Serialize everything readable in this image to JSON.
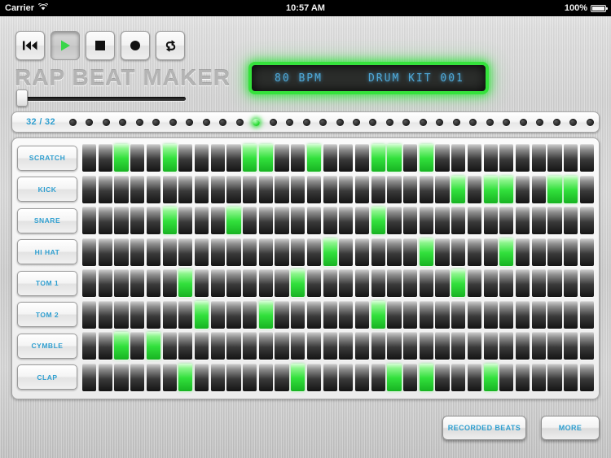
{
  "status_bar": {
    "carrier": "Carrier",
    "wifi_icon": "wifi-icon",
    "time": "10:57 AM",
    "battery_percent": "100%",
    "battery_icon": "battery-full-icon"
  },
  "app": {
    "title": "RAP BEAT MAKER"
  },
  "transport": {
    "buttons": [
      {
        "name": "rewind-button",
        "icon": "rewind-icon",
        "active": false
      },
      {
        "name": "play-button",
        "icon": "play-icon",
        "active": true
      },
      {
        "name": "stop-button",
        "icon": "stop-icon",
        "active": false
      },
      {
        "name": "record-button",
        "icon": "record-icon",
        "active": false
      },
      {
        "name": "loop-button",
        "icon": "loop-icon",
        "active": false
      }
    ]
  },
  "volume_slider": {
    "name": "volume-slider",
    "value_percent": 2
  },
  "lcd": {
    "bpm": "80 BPM",
    "kit": "DRUM KIT 001",
    "text_color": "#4ea8d8",
    "glow_color": "#35e23c"
  },
  "step_bar": {
    "count_label": "32 / 32",
    "total_steps": 32,
    "current_step": 12
  },
  "colors": {
    "accent_blue": "#2f9fd0",
    "active_green": "#32e03c",
    "lcd_blue": "#4ea8d8"
  },
  "sequencer": {
    "total_steps": 32,
    "tracks": [
      {
        "label": "SCRATCH",
        "steps": [
          3,
          6,
          11,
          12,
          15,
          19,
          20,
          22
        ]
      },
      {
        "label": "KICK",
        "steps": [
          24,
          26,
          27,
          30,
          31
        ]
      },
      {
        "label": "SNARE",
        "steps": [
          6,
          10,
          19
        ]
      },
      {
        "label": "HI HAT",
        "steps": [
          16,
          22,
          27
        ]
      },
      {
        "label": "TOM 1",
        "steps": [
          7,
          14,
          24
        ]
      },
      {
        "label": "TOM 2",
        "steps": [
          8,
          12,
          19
        ]
      },
      {
        "label": "CYMBLE",
        "steps": [
          3,
          5
        ]
      },
      {
        "label": "CLAP",
        "steps": [
          7,
          14,
          20,
          22,
          26
        ]
      }
    ]
  },
  "footer": {
    "recorded_beats_label": "RECORDED BEATS",
    "more_label": "MORE"
  }
}
